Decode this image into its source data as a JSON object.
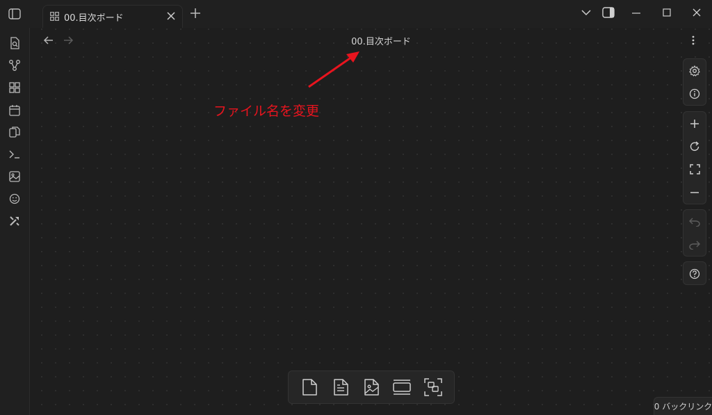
{
  "tab": {
    "title": "00.目次ボード",
    "icon": "board-grid-icon"
  },
  "view": {
    "title": "00.目次ボード"
  },
  "annotation": {
    "text": "ファイル名を変更",
    "color": "#e8141e"
  },
  "ribbon": {
    "items": [
      {
        "name": "file-search-icon"
      },
      {
        "name": "graph-view-icon"
      },
      {
        "name": "board-grid-icon"
      },
      {
        "name": "calendar-icon"
      },
      {
        "name": "copy-files-icon"
      },
      {
        "name": "terminal-icon"
      },
      {
        "name": "image-icon"
      },
      {
        "name": "smiley-icon"
      },
      {
        "name": "tools-icon"
      }
    ]
  },
  "controls": {
    "settings": "gear-icon",
    "info": "info-icon",
    "zoom_in": "plus-icon",
    "reset": "rotate-icon",
    "fit": "fullscreen-icon",
    "zoom_out": "minus-icon",
    "undo": "undo-icon",
    "redo": "redo-icon",
    "help": "help-icon"
  },
  "bottom_toolbar": {
    "items": [
      "new-card-icon",
      "note-icon",
      "media-icon",
      "group-icon",
      "selection-icon"
    ]
  },
  "status": {
    "backlinks": "0 バックリンク"
  },
  "colors": {
    "background": "#1e1e1e",
    "accent_annotation": "#e8141e"
  }
}
